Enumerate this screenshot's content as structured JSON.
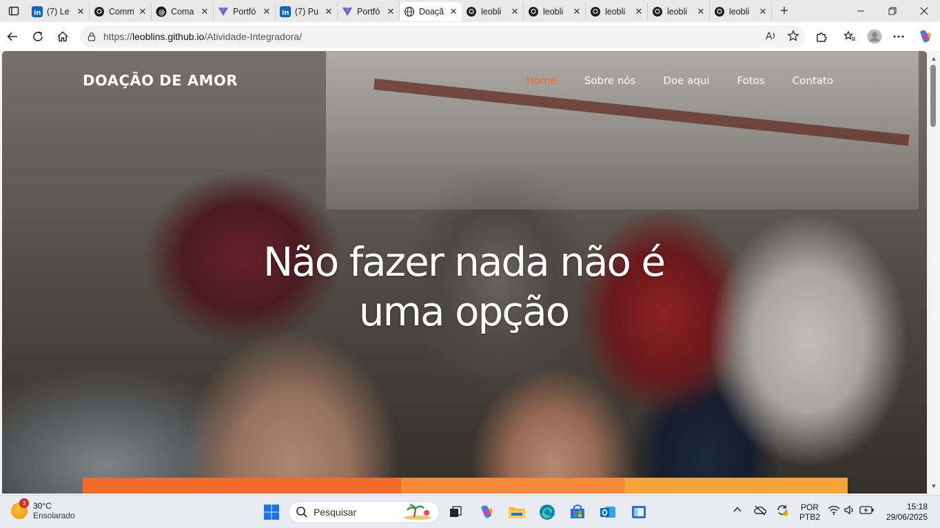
{
  "browser": {
    "tabs": [
      {
        "title": "(7) Le",
        "icon": "linkedin-icon",
        "active": false
      },
      {
        "title": "Comm",
        "icon": "github-icon",
        "active": false
      },
      {
        "title": "Coma",
        "icon": "threads-icon",
        "active": false
      },
      {
        "title": "Portfó",
        "icon": "vercel-portfolio-icon",
        "active": false
      },
      {
        "title": "(7) Pu",
        "icon": "linkedin-icon",
        "active": false
      },
      {
        "title": "Portfó",
        "icon": "vercel-portfolio-icon",
        "active": false
      },
      {
        "title": "Doaçã",
        "icon": "globe-icon",
        "active": true
      },
      {
        "title": "leobli",
        "icon": "github-icon",
        "active": false
      },
      {
        "title": "leobli",
        "icon": "github-icon",
        "active": false
      },
      {
        "title": "leobli",
        "icon": "github-icon",
        "active": false
      },
      {
        "title": "leobli",
        "icon": "github-icon",
        "active": false
      },
      {
        "title": "leobli",
        "icon": "github-icon",
        "active": false
      }
    ],
    "url": {
      "scheme": "https://",
      "host": "leoblins.github.io",
      "path": "/Atividade-Integradora/"
    }
  },
  "site": {
    "brand": "DOAÇÃO DE AMOR",
    "menu": [
      {
        "label": "Home",
        "active": true
      },
      {
        "label": "Sobre nós",
        "active": false
      },
      {
        "label": "Doe aqui",
        "active": false
      },
      {
        "label": "Fotos",
        "active": false
      },
      {
        "label": "Contato",
        "active": false
      }
    ],
    "headline": "Não fazer nada não é uma opção",
    "accent_colors": [
      "#f26b2a",
      "#f7893a",
      "#f6a338"
    ]
  },
  "taskbar": {
    "weather": {
      "temp": "30°C",
      "condition": "Ensolarado",
      "badge": "3"
    },
    "search_placeholder": "Pesquisar",
    "language": {
      "line1": "POR",
      "line2": "PTB2"
    },
    "clock": {
      "time": "15:18",
      "date": "29/06/2025"
    }
  }
}
